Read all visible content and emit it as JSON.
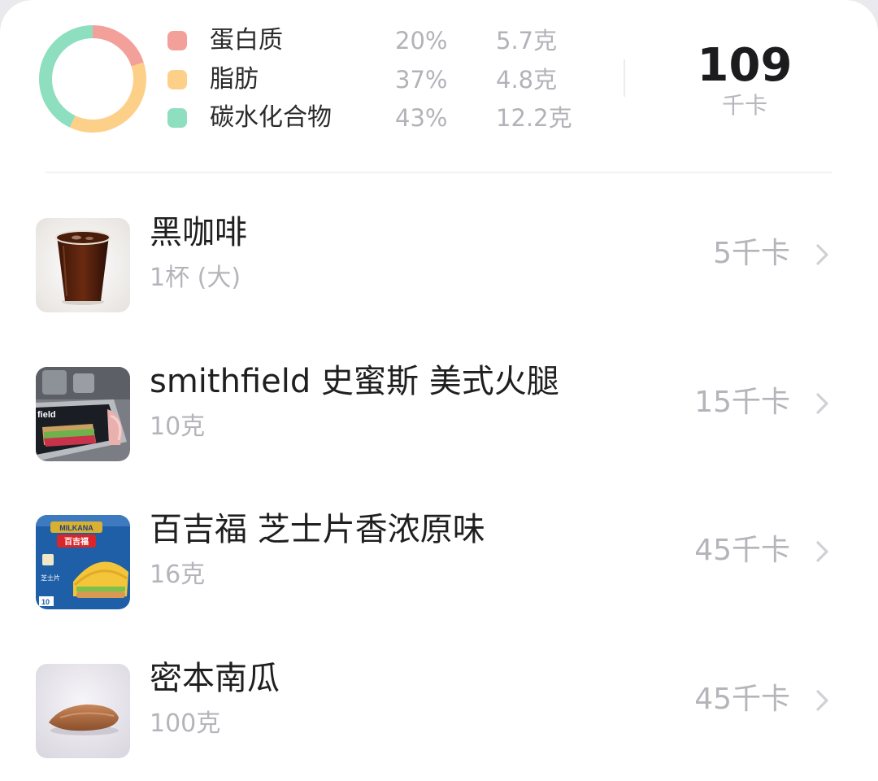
{
  "summary": {
    "macros": [
      {
        "name": "蛋白质",
        "percent": "20%",
        "grams": "5.7克",
        "color": "#f4a09a"
      },
      {
        "name": "脂肪",
        "percent": "37%",
        "grams": "4.8克",
        "color": "#fdd08a"
      },
      {
        "name": "碳水化合物",
        "percent": "43%",
        "grams": "12.2克",
        "color": "#8ddfbf"
      }
    ],
    "total_kcal": "109",
    "kcal_unit": "千卡"
  },
  "chart_data": {
    "type": "pie",
    "categories": [
      "蛋白质",
      "脂肪",
      "碳水化合物"
    ],
    "values": [
      20,
      37,
      43
    ],
    "colors": [
      "#f4a09a",
      "#fdd08a",
      "#8ddfbf"
    ],
    "style": "donut"
  },
  "foods": [
    {
      "name": "黑咖啡",
      "portion": "1杯 (大)",
      "kcal": "5千卡",
      "image_icon": "iced-coffee-cup-icon"
    },
    {
      "name": "smithfield 史蜜斯 美式火腿",
      "portion": "10克",
      "kcal": "15千卡",
      "image_icon": "ham-package-icon"
    },
    {
      "name": "百吉福 芝士片香浓原味",
      "portion": "16克",
      "kcal": "45千卡",
      "image_icon": "cheese-slices-package-icon"
    },
    {
      "name": "密本南瓜",
      "portion": "100克",
      "kcal": "45千卡",
      "image_icon": "pumpkin-icon"
    }
  ],
  "product_labels": {
    "cheese_brand": "MILKANA",
    "cheese_brand_cn": "百吉福",
    "cheese_product": "芝士片",
    "ham_brand_fragment": "field"
  }
}
